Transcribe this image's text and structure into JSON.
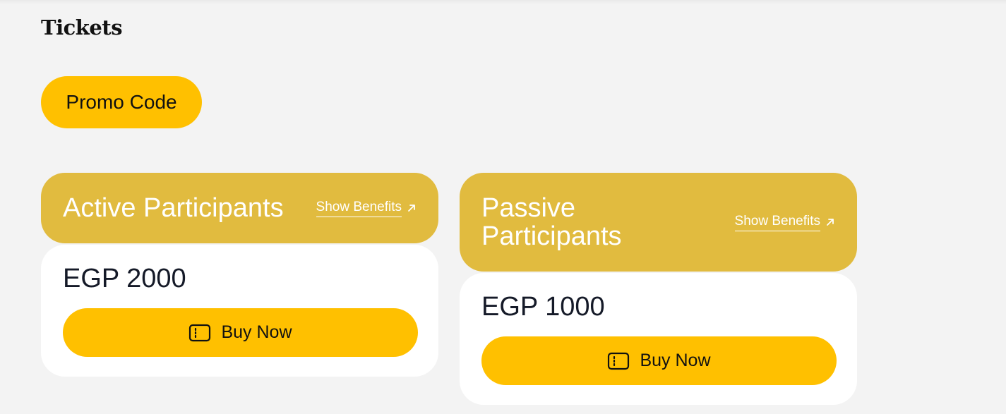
{
  "section": {
    "title": "Tickets"
  },
  "promo": {
    "label": "Promo Code"
  },
  "tickets": [
    {
      "title": "Active Participants",
      "benefits_label": "Show Benefits",
      "price": "EGP 2000",
      "buy_label": "Buy Now"
    },
    {
      "title": "Passive Participants",
      "benefits_label": "Show Benefits",
      "price": "EGP 1000",
      "buy_label": "Buy Now"
    }
  ],
  "icons": {
    "benefits": "arrow-up-right-icon",
    "buy": "ticket-icon"
  },
  "colors": {
    "background": "#f3f3f3",
    "accent": "#ffc000",
    "header": "#e1bb3f",
    "card": "#ffffff",
    "text": "#111111"
  }
}
